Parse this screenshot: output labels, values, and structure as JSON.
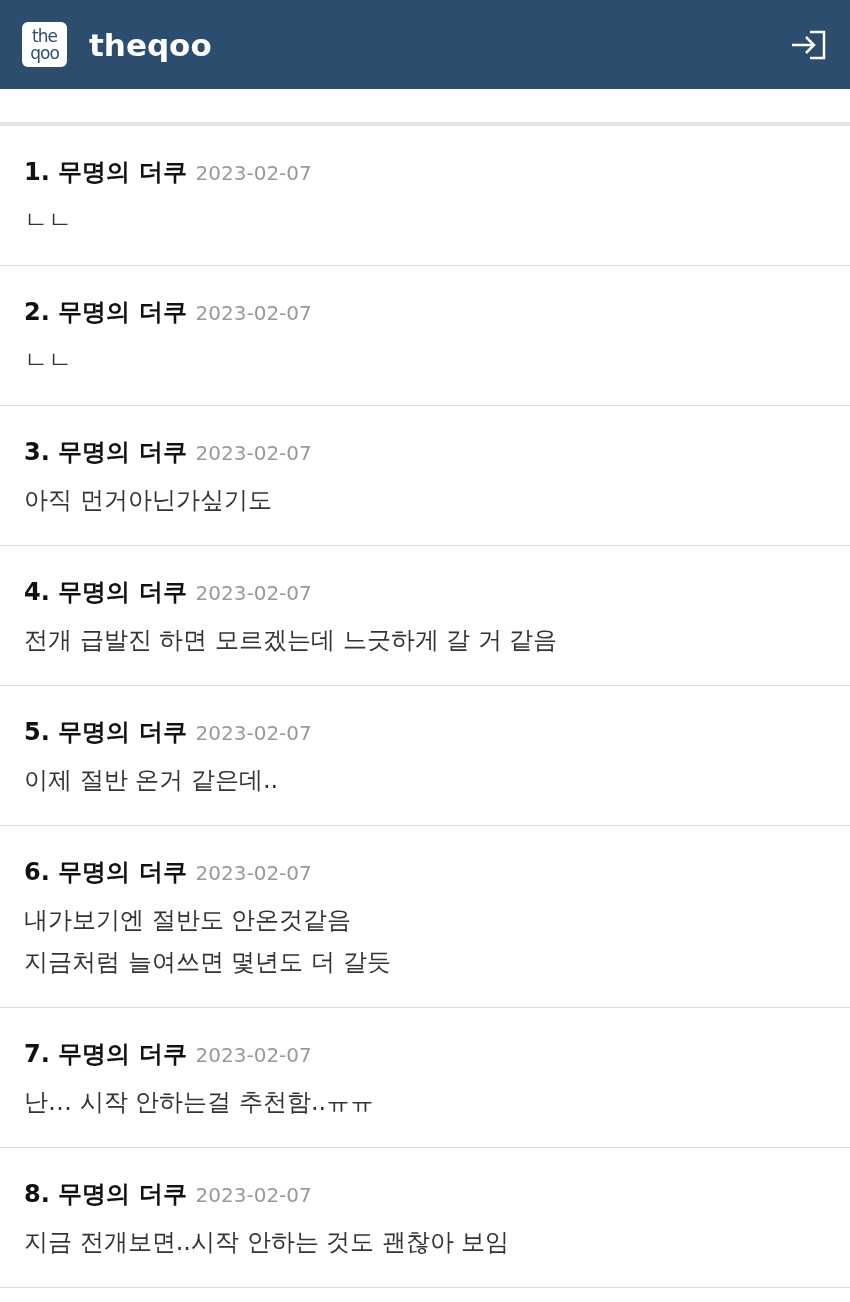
{
  "header": {
    "logo_lines": [
      "the",
      "qoo"
    ],
    "title": "theqoo"
  },
  "comments": [
    {
      "number": "1.",
      "author": "무명의 더쿠",
      "date": "2023-02-07",
      "text": "ㄴㄴ"
    },
    {
      "number": "2.",
      "author": "무명의 더쿠",
      "date": "2023-02-07",
      "text": "ㄴㄴ"
    },
    {
      "number": "3.",
      "author": "무명의 더쿠",
      "date": "2023-02-07",
      "text": "아직 먼거아닌가싶기도"
    },
    {
      "number": "4.",
      "author": "무명의 더쿠",
      "date": "2023-02-07",
      "text": "전개 급발진 하면 모르겠는데 느긋하게 갈 거 같음"
    },
    {
      "number": "5.",
      "author": "무명의 더쿠",
      "date": "2023-02-07",
      "text": "이제 절반 온거 같은데.."
    },
    {
      "number": "6.",
      "author": "무명의 더쿠",
      "date": "2023-02-07",
      "text": "내가보기엔 절반도 안온것같음\n지금처럼 늘여쓰면 몇년도 더 갈듯"
    },
    {
      "number": "7.",
      "author": "무명의 더쿠",
      "date": "2023-02-07",
      "text": "난… 시작 안하는걸 추천함..ㅠㅠ"
    },
    {
      "number": "8.",
      "author": "무명의 더쿠",
      "date": "2023-02-07",
      "text": "지금 전개보면..시작 안하는 것도 괜찮아 보임"
    }
  ]
}
